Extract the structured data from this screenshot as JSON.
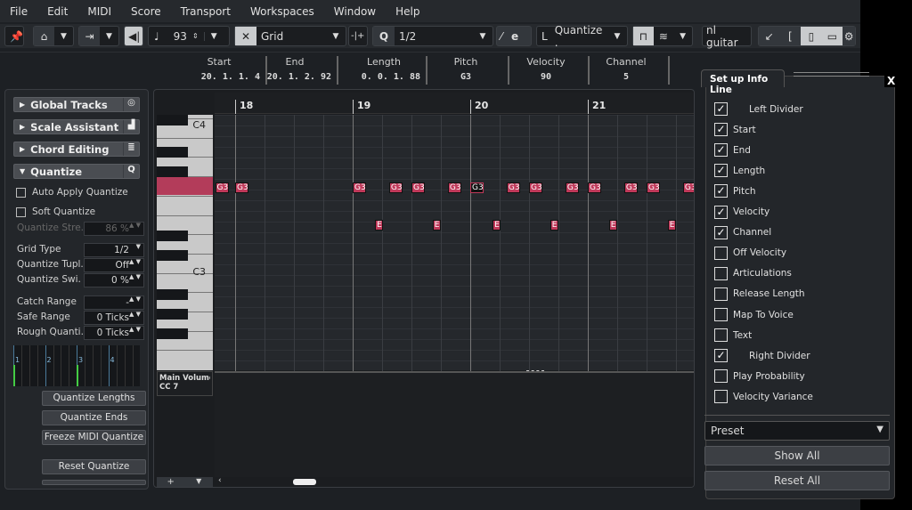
{
  "menu": [
    "File",
    "Edit",
    "MIDI",
    "Score",
    "Transport",
    "Workspaces",
    "Window",
    "Help"
  ],
  "toolbar": {
    "velocity": "93",
    "snap_mode": "Grid",
    "quantize": "1/2",
    "quantize_preset": "Quantize .",
    "track_name": "nl guitar"
  },
  "infoline": {
    "columns": [
      {
        "label": "Start",
        "value": "20. 1. 1.  4"
      },
      {
        "label": "End",
        "value": "20. 1. 2. 92"
      },
      {
        "label": "Length",
        "value": "0. 0. 1. 88"
      },
      {
        "label": "Pitch",
        "value": "G3"
      },
      {
        "label": "Velocity",
        "value": "90"
      },
      {
        "label": "Channel",
        "value": "5"
      }
    ]
  },
  "left": {
    "sections": [
      "Global Tracks",
      "Scale Assistant",
      "Chord Editing",
      "Quantize"
    ],
    "auto_apply": "Auto Apply Quantize",
    "soft": "Soft Quantize",
    "fields": [
      {
        "label": "Quantize Stre.",
        "value": "86 %"
      },
      {
        "label": "Grid Type",
        "value": "1/2"
      },
      {
        "label": "Quantize Tupl.",
        "value": "Off"
      },
      {
        "label": "Quantize Swi.",
        "value": "0 %"
      },
      {
        "label": "Catch Range",
        "value": "-"
      },
      {
        "label": "Safe Range",
        "value": "0 Ticks"
      },
      {
        "label": "Rough Quanti.",
        "value": "0 Ticks"
      }
    ],
    "beats": [
      "1",
      "2",
      "3",
      "4"
    ],
    "buttons": [
      "Quantize Lengths",
      "Quantize Ends",
      "Freeze MIDI Quantize",
      "Reset Quantize"
    ]
  },
  "editor": {
    "bars": [
      "18",
      "19",
      "20",
      "21"
    ],
    "key_c4": "C4",
    "key_c3": "C3",
    "lane_name": "Main Volume",
    "lane_cc": "CC 7",
    "notes": [
      {
        "pos": 17.83,
        "label": "G3",
        "row": "g"
      },
      {
        "pos": 18.0,
        "label": "G3",
        "row": "g"
      },
      {
        "pos": 19.0,
        "label": "G3",
        "row": "g"
      },
      {
        "pos": 19.31,
        "label": "G3",
        "row": "g"
      },
      {
        "pos": 19.5,
        "label": "G3",
        "row": "g"
      },
      {
        "pos": 19.81,
        "label": "G3",
        "row": "g"
      },
      {
        "pos": 20.0,
        "label": "G3",
        "row": "g",
        "selected": true
      },
      {
        "pos": 20.31,
        "label": "G3",
        "row": "g"
      },
      {
        "pos": 20.5,
        "label": "G3",
        "row": "g"
      },
      {
        "pos": 20.81,
        "label": "G3",
        "row": "g"
      },
      {
        "pos": 21.0,
        "label": "G3",
        "row": "g"
      },
      {
        "pos": 21.31,
        "label": "G3",
        "row": "g"
      },
      {
        "pos": 21.5,
        "label": "G3",
        "row": "g"
      },
      {
        "pos": 21.81,
        "label": "G3",
        "row": "g"
      },
      {
        "pos": 19.19,
        "label": "E",
        "row": "e"
      },
      {
        "pos": 19.68,
        "label": "E",
        "row": "e"
      },
      {
        "pos": 20.19,
        "label": "E",
        "row": "e"
      },
      {
        "pos": 20.68,
        "label": "E",
        "row": "e"
      },
      {
        "pos": 21.18,
        "label": "E",
        "row": "e"
      },
      {
        "pos": 21.68,
        "label": "E",
        "row": "e"
      }
    ]
  },
  "setup": {
    "title": "Set up Info Line",
    "close": "X",
    "items": [
      {
        "label": "Left Divider",
        "checked": true,
        "indent": true
      },
      {
        "label": "Start",
        "checked": true
      },
      {
        "label": "End",
        "checked": true
      },
      {
        "label": "Length",
        "checked": true
      },
      {
        "label": "Pitch",
        "checked": true
      },
      {
        "label": "Velocity",
        "checked": true
      },
      {
        "label": "Channel",
        "checked": true
      },
      {
        "label": "Off Velocity",
        "checked": false
      },
      {
        "label": "Articulations",
        "checked": false
      },
      {
        "label": "Release Length",
        "checked": false
      },
      {
        "label": "Map To Voice",
        "checked": false
      },
      {
        "label": "Text",
        "checked": false
      },
      {
        "label": "Right Divider",
        "checked": true,
        "indent": true
      },
      {
        "label": "Play Probability",
        "checked": false
      },
      {
        "label": "Velocity Variance",
        "checked": false
      }
    ],
    "preset": "Preset",
    "show_all": "Show All",
    "reset_all": "Reset All"
  },
  "colors": {
    "note": "#c0395a",
    "background": "#1d2024"
  }
}
